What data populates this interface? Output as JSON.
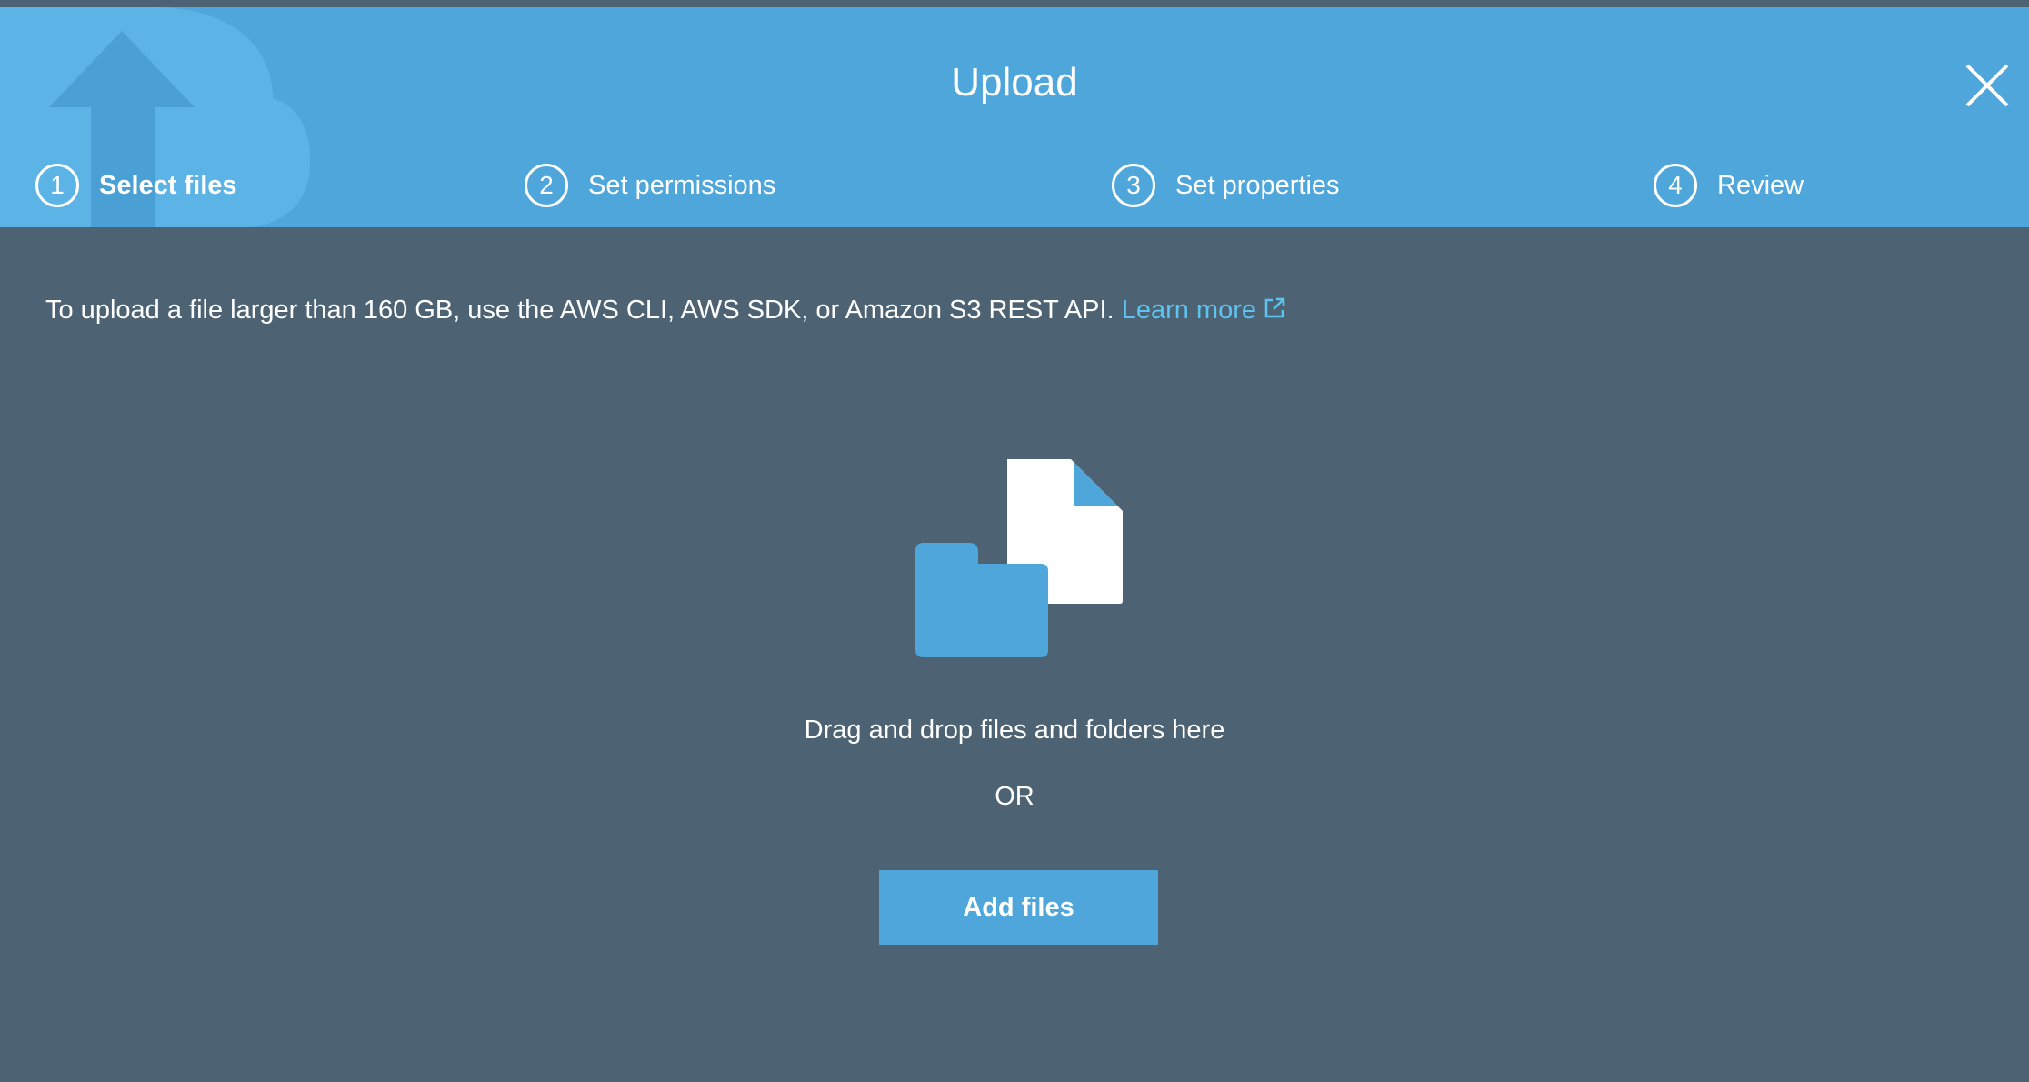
{
  "dialog": {
    "title": "Upload",
    "close_icon": "close-icon",
    "header_bg_icon": "cloud-upload-icon"
  },
  "steps": [
    {
      "number": "1",
      "label": "Select files",
      "active": true
    },
    {
      "number": "2",
      "label": "Set permissions",
      "active": false
    },
    {
      "number": "3",
      "label": "Set properties",
      "active": false
    },
    {
      "number": "4",
      "label": "Review",
      "active": false
    }
  ],
  "info": {
    "text": "To upload a file larger than 160 GB, use the AWS CLI, AWS SDK, or Amazon S3 REST API.",
    "link_label": "Learn more",
    "link_icon": "external-link-icon"
  },
  "dropzone": {
    "icon": "files-and-folder-icon",
    "drop_text": "Drag and drop files and folders here",
    "or_text": "OR",
    "add_button_label": "Add files"
  },
  "colors": {
    "header_bg": "#4ea6db",
    "body_bg": "#4d6373",
    "link": "#5cc4f0",
    "button_bg": "#4ea6db",
    "text": "#ffffff"
  }
}
